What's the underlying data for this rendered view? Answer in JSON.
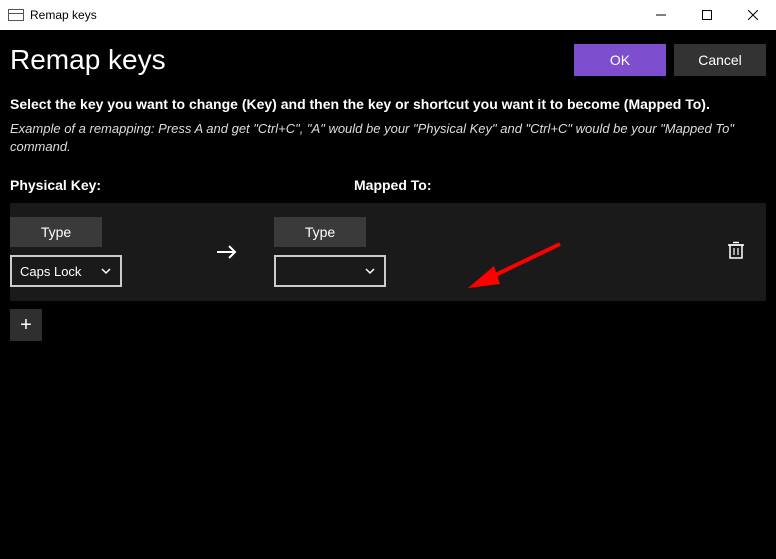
{
  "window": {
    "title": "Remap keys"
  },
  "header": {
    "title": "Remap keys",
    "ok_label": "OK",
    "cancel_label": "Cancel"
  },
  "text": {
    "description": "Select the key you want to change (Key) and then the key or shortcut you want it to become (Mapped To).",
    "example": "Example of a remapping: Press A and get \"Ctrl+C\", \"A\" would be your \"Physical Key\" and \"Ctrl+C\" would be your \"Mapped To\" command."
  },
  "columns": {
    "physical_label": "Physical Key:",
    "mapped_label": "Mapped To:"
  },
  "row": {
    "type_label": "Type",
    "physical_value": "Caps Lock",
    "mapped_value": ""
  },
  "icons": {
    "add_label": "+"
  }
}
